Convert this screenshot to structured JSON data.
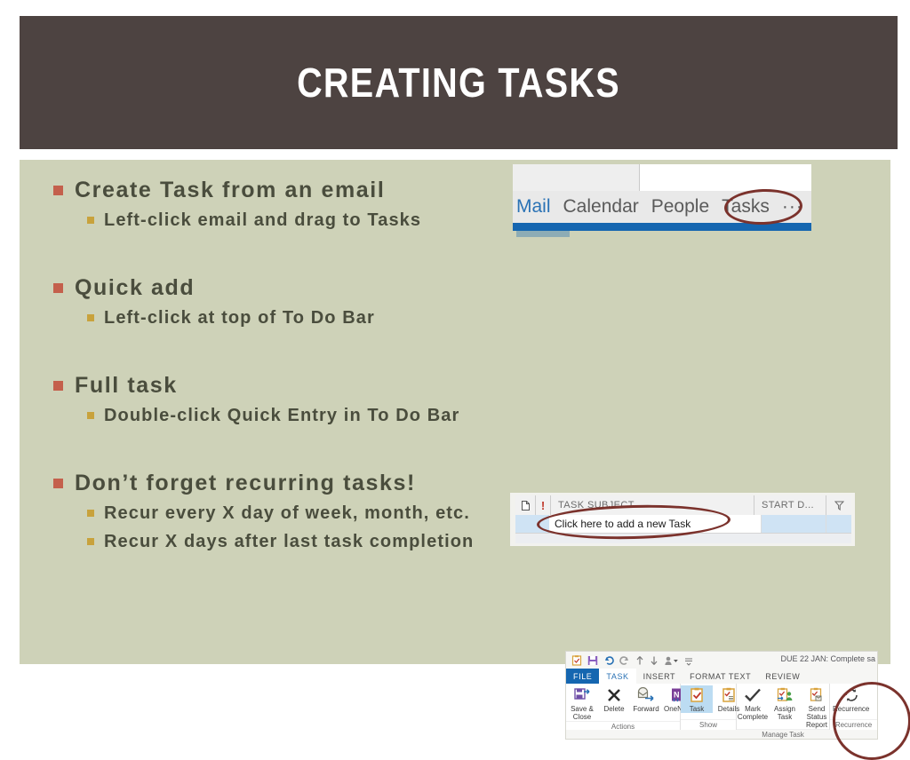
{
  "slide": {
    "title": "CREATING TASKS",
    "colors": {
      "title_bar": "#4d4341",
      "body_panel": "#ced2b8",
      "bullet_level1_marker": "#c4604c",
      "bullet_level2_marker": "#c8a23c",
      "bullet_text": "#4a4d3d",
      "annotation_circle": "#7b322c",
      "outlook_blue": "#1566b0"
    },
    "bullets": [
      {
        "level": 1,
        "text": "Create Task from an email"
      },
      {
        "level": 2,
        "text": "Left-click email and drag to Tasks"
      },
      {
        "level": 1,
        "text": "Quick add"
      },
      {
        "level": 2,
        "text": "Left-click at top of To Do Bar"
      },
      {
        "level": 1,
        "text": "Full task"
      },
      {
        "level": 2,
        "text": "Double-click Quick Entry in To Do Bar"
      },
      {
        "level": 1,
        "text": "Don’t forget recurring tasks!"
      },
      {
        "level": 2,
        "text": "Recur every X day of week, month, etc."
      },
      {
        "level": 2,
        "text": "Recur X days after last task completion"
      }
    ]
  },
  "nav_inset": {
    "items": [
      "Mail",
      "Calendar",
      "People",
      "Tasks"
    ],
    "overflow": "···",
    "active_item": "Mail",
    "circled_item": "Tasks"
  },
  "list_inset": {
    "header": {
      "doc_icon": "page-icon",
      "importance_icon": "!",
      "subject": "TASK SUBJECT",
      "start_date": "START D...",
      "flag_icon": "flag-icon"
    },
    "row_text": "Click here to add a new Task"
  },
  "ribbon_inset": {
    "window_title": "DUE 22 JAN: Complete sa",
    "quick_access": [
      "task-icon",
      "save-icon",
      "undo-icon",
      "redo-icon",
      "up-icon",
      "down-icon",
      "person-icon",
      "customize-icon"
    ],
    "tabs": [
      "FILE",
      "TASK",
      "INSERT",
      "FORMAT TEXT",
      "REVIEW"
    ],
    "active_tab": "TASK",
    "groups": [
      {
        "label": "Actions",
        "buttons": [
          {
            "line1": "Save &",
            "line2": "Close",
            "icon": "save-close-icon"
          },
          {
            "line1": "Delete",
            "line2": "",
            "icon": "delete-x-icon"
          },
          {
            "line1": "Forward",
            "line2": "",
            "icon": "forward-envelope-icon"
          },
          {
            "line1": "OneNote",
            "line2": "",
            "icon": "onenote-icon"
          }
        ]
      },
      {
        "label": "Show",
        "buttons": [
          {
            "line1": "Task",
            "line2": "",
            "icon": "task-clipboard-icon",
            "selected": true
          },
          {
            "line1": "Details",
            "line2": "",
            "icon": "details-clipboard-icon"
          }
        ]
      },
      {
        "label": "Manage Task",
        "buttons": [
          {
            "line1": "Mark",
            "line2": "Complete",
            "icon": "checkmark-icon"
          },
          {
            "line1": "Assign",
            "line2": "Task",
            "icon": "assign-task-icon"
          },
          {
            "line1": "Send Status",
            "line2": "Report",
            "icon": "send-status-icon"
          }
        ]
      },
      {
        "label": "Recurrence",
        "buttons": [
          {
            "line1": "Recurrence",
            "line2": "",
            "icon": "recurrence-icon"
          }
        ]
      }
    ],
    "circled_button": "Recurrence"
  }
}
